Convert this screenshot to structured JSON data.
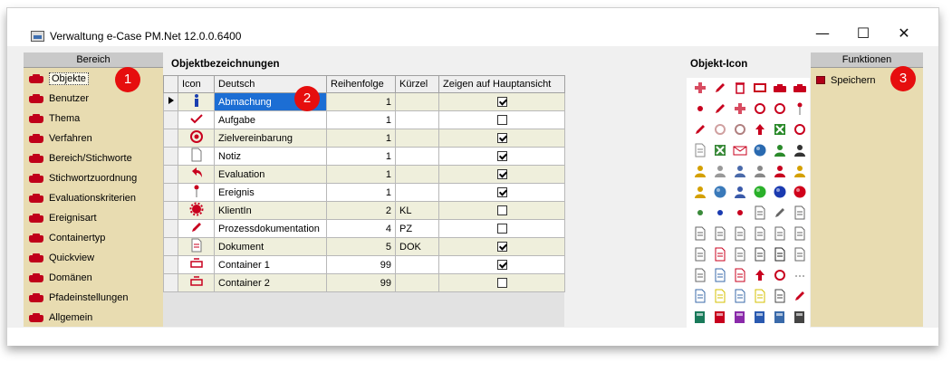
{
  "window": {
    "title": "Verwaltung e-Case PM.Net 12.0.0.6400",
    "minimize_glyph": "—",
    "maximize_glyph": "☐",
    "close_glyph": "✕"
  },
  "left_panel": {
    "header": "Bereich",
    "items": [
      {
        "label": "Objekte",
        "selected": true
      },
      {
        "label": "Benutzer"
      },
      {
        "label": "Thema"
      },
      {
        "label": "Verfahren"
      },
      {
        "label": "Bereich/Stichworte"
      },
      {
        "label": "Stichwortzuordnung"
      },
      {
        "label": "Evaluationskriterien"
      },
      {
        "label": "Ereignisart"
      },
      {
        "label": "Containertyp"
      },
      {
        "label": "Quickview"
      },
      {
        "label": "Domänen"
      },
      {
        "label": "Pfadeinstellungen"
      },
      {
        "label": "Allgemein"
      }
    ]
  },
  "main": {
    "title": "Objektbezeichnungen",
    "columns": {
      "icon": "Icon",
      "deutsch": "Deutsch",
      "reihenfolge": "Reihenfolge",
      "kuerzel": "Kürzel",
      "zeigen": "Zeigen auf Hauptansicht"
    },
    "rows": [
      {
        "icon": "info-icon",
        "deutsch": "Abmachung",
        "reihenfolge": "1",
        "kuerzel": "",
        "zeigen": true
      },
      {
        "icon": "checkmark-icon",
        "deutsch": "Aufgabe",
        "reihenfolge": "1",
        "kuerzel": "",
        "zeigen": false
      },
      {
        "icon": "target-icon",
        "deutsch": "Zielvereinbarung",
        "reihenfolge": "1",
        "kuerzel": "",
        "zeigen": true
      },
      {
        "icon": "note-icon",
        "deutsch": "Notiz",
        "reihenfolge": "1",
        "kuerzel": "",
        "zeigen": true
      },
      {
        "icon": "return-arrow-icon",
        "deutsch": "Evaluation",
        "reihenfolge": "1",
        "kuerzel": "",
        "zeigen": true
      },
      {
        "icon": "pin-icon",
        "deutsch": "Ereignis",
        "reihenfolge": "1",
        "kuerzel": "",
        "zeigen": true
      },
      {
        "icon": "gear-icon",
        "deutsch": "KlientIn",
        "reihenfolge": "2",
        "kuerzel": "KL",
        "zeigen": false
      },
      {
        "icon": "pencil-icon",
        "deutsch": "Prozessdokumentation",
        "reihenfolge": "4",
        "kuerzel": "PZ",
        "zeigen": false
      },
      {
        "icon": "document-icon",
        "deutsch": "Dokument",
        "reihenfolge": "5",
        "kuerzel": "DOK",
        "zeigen": true
      },
      {
        "icon": "container-icon",
        "deutsch": "Container 1",
        "reihenfolge": "99",
        "kuerzel": "",
        "zeigen": true
      },
      {
        "icon": "container-icon",
        "deutsch": "Container 2",
        "reihenfolge": "99",
        "kuerzel": "",
        "zeigen": false
      }
    ]
  },
  "icon_palette": {
    "title": "Objekt-Icon"
  },
  "right_panel": {
    "header": "Funktionen",
    "items": [
      {
        "label": "Speichern",
        "icon": "save-icon"
      }
    ]
  },
  "badges": [
    "1",
    "2",
    "3"
  ]
}
